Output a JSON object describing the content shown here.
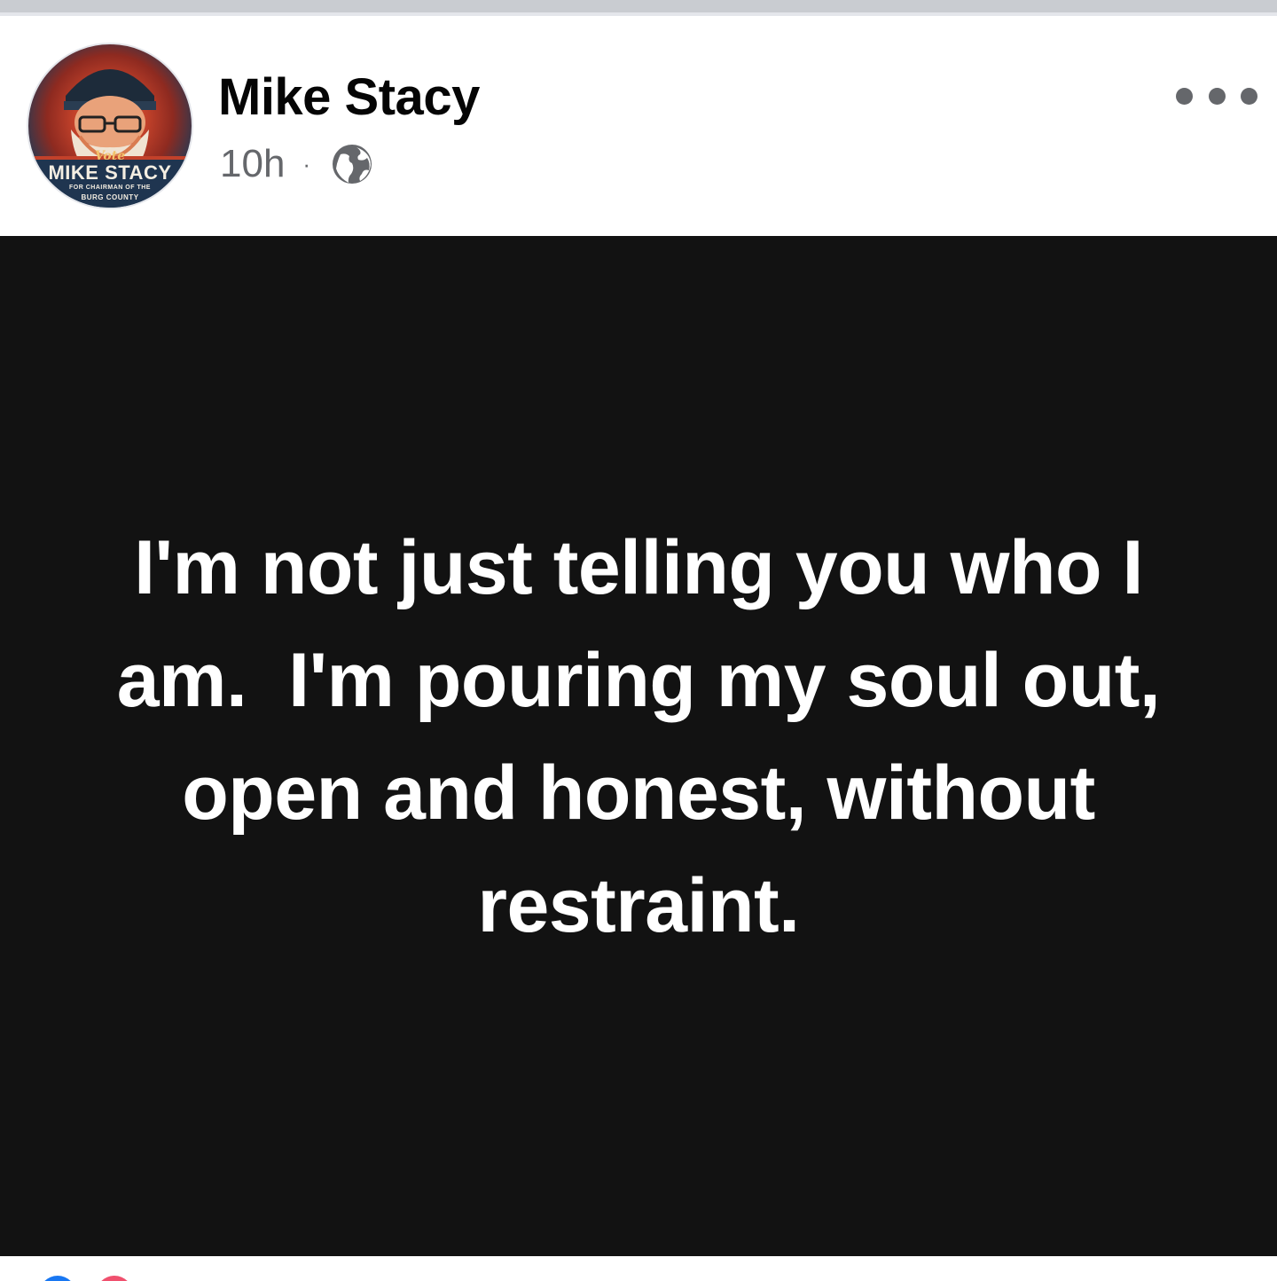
{
  "post": {
    "author_name": "Mike Stacy",
    "timestamp": "10h",
    "separator": "·",
    "visibility_icon": "globe-icon",
    "more_icon": "more-options-icon",
    "avatar": {
      "vote_text": "Vote",
      "name_text": "MIKE STACY",
      "sub_text": "FOR CHAIRMAN OF THE",
      "sub_text_2": "BURG COUNTY"
    },
    "body_text": "I'm not just telling you who I am.  I'm pouring my soul out, open and honest, without restraint."
  },
  "colors": {
    "background_post": "#121212",
    "text_on_post": "#ffffff",
    "name_color": "#050505",
    "meta_color": "#65676b",
    "like_blue": "#1877f2",
    "love_pink": "#f0506e"
  }
}
